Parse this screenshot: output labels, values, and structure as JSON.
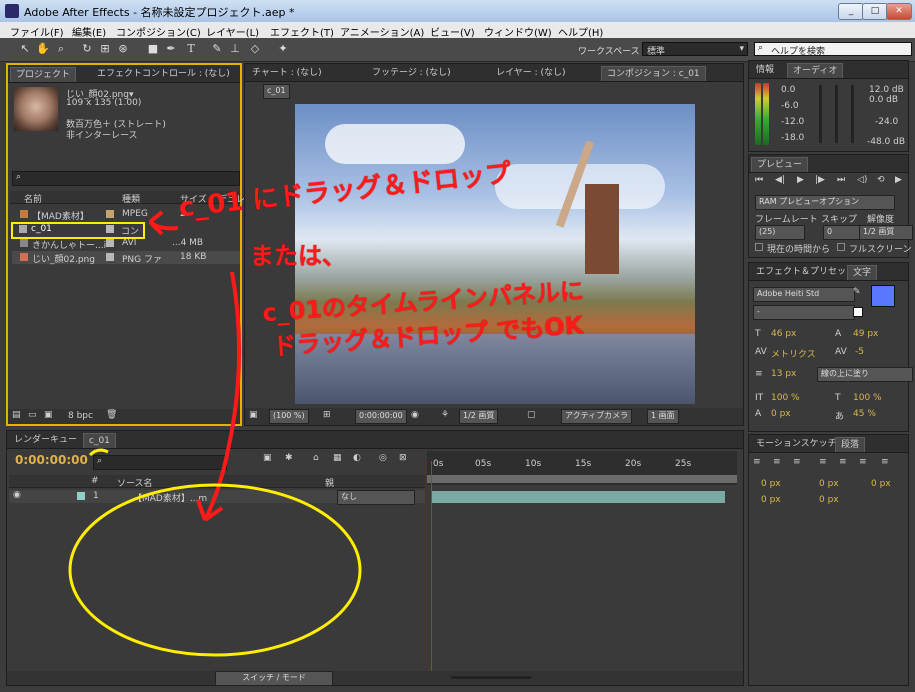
{
  "window": {
    "title": "Adobe After Effects - 名称未設定プロジェクト.aep *"
  },
  "menu": [
    "ファイル(F)",
    "編集(E)",
    "コンポジション(C)",
    "レイヤー(L)",
    "エフェクト(T)",
    "アニメーション(A)",
    "ビュー(V)",
    "ウィンドウ(W)",
    "ヘルプ(H)"
  ],
  "toolbar": {
    "workspace_label": "ワークスペース :",
    "workspace_value": "標準",
    "help_placeholder": "ヘルプを検索"
  },
  "project_panel": {
    "tabs": [
      "プロジェクト",
      "エフェクトコントロール : (なし)"
    ],
    "preview_name": "じい_顔02.png▾",
    "preview_dims": "109 x 135 (1.00)",
    "preview_color": "数百万色＋ (ストレート)",
    "preview_field": "非インターレース",
    "columns": [
      "名前",
      "種類",
      "サイズ",
      "デュレ"
    ],
    "items": [
      {
        "name": "【MAD素材】",
        "type": "MPEG",
        "size": "2",
        "color": "#c9a36a"
      },
      {
        "name": "c_01",
        "type": "コン",
        "size": "",
        "color": "#b8b8b8"
      },
      {
        "name": "きかんしゃトー...i",
        "type": "AVI",
        "size": "...4 MB",
        "color": "#b8b8b8"
      },
      {
        "name": "じい_顔02.png",
        "type": "PNG ファ",
        "size": "18 KB",
        "color": "#b8b8b8"
      }
    ],
    "bpc": "8 bpc"
  },
  "comp_panel": {
    "tabs": [
      "チャート : (なし)",
      "フッテージ : (なし)",
      "レイヤー : (なし)",
      "コンポジション : c_01"
    ],
    "breadcrumb": "c_01",
    "zoom": "(100 %)",
    "timecode": "0:00:00:00",
    "resolution": "1/2 画質",
    "camera": "アクティブカメラ",
    "view": "1 画面"
  },
  "info_panel": {
    "tabs": [
      "情報",
      "オーディオ"
    ],
    "db_right": [
      "12.0 dB",
      "0.0 dB",
      "-24.0",
      "-48.0 dB"
    ],
    "db_left": [
      "0.0",
      "-6.0",
      "-12.0",
      "-18.0"
    ]
  },
  "preview_panel": {
    "tab": "プレビュー",
    "ram_option": "RAM プレビューオプション",
    "labels": [
      "フレームレート",
      "スキップ",
      "解像度"
    ],
    "values": [
      "(25)",
      "0",
      "1/2 画質"
    ],
    "from_current": "現在の時間から",
    "fullscreen": "フルスクリーン"
  },
  "character_panel": {
    "tabs": [
      "エフェクト＆プリセット",
      "文字"
    ],
    "font": "Adobe Heiti Std",
    "style": "-",
    "size": "46 px",
    "leading": "49 px",
    "kerning": "メトリクス",
    "tracking": "-5",
    "stroke": "13 px",
    "stroke_mode": "線の上に塗り",
    "vscale": "100 %",
    "hscale": "100 %",
    "baseline": "0 px",
    "tsume": "45 %",
    "swatch_color": "#5a78ff"
  },
  "paragraph_panel": {
    "tabs": [
      "モーションスケッチ",
      "段落"
    ],
    "values": [
      "0 px",
      "0 px",
      "0 px",
      "0 px",
      "0 px"
    ]
  },
  "timeline": {
    "tabs": [
      "レンダーキュー",
      "c_01"
    ],
    "timecode": "0:00:00:00",
    "columns": [
      "#",
      "ソース名",
      "親"
    ],
    "ruler": [
      "0s",
      "05s",
      "10s",
      "15s",
      "20s",
      "25s"
    ],
    "layer": {
      "index": "1",
      "name": "【MAD素材】...m",
      "parent": "なし"
    },
    "footer_button": "スイッチ / モード"
  },
  "annotations": {
    "line1": "c_01 にドラッグ＆ドロップ",
    "line2": "または、",
    "line3": "c_01のタイムラインパネルに",
    "line4": "ドラッグ＆ドロップ でもOK"
  }
}
